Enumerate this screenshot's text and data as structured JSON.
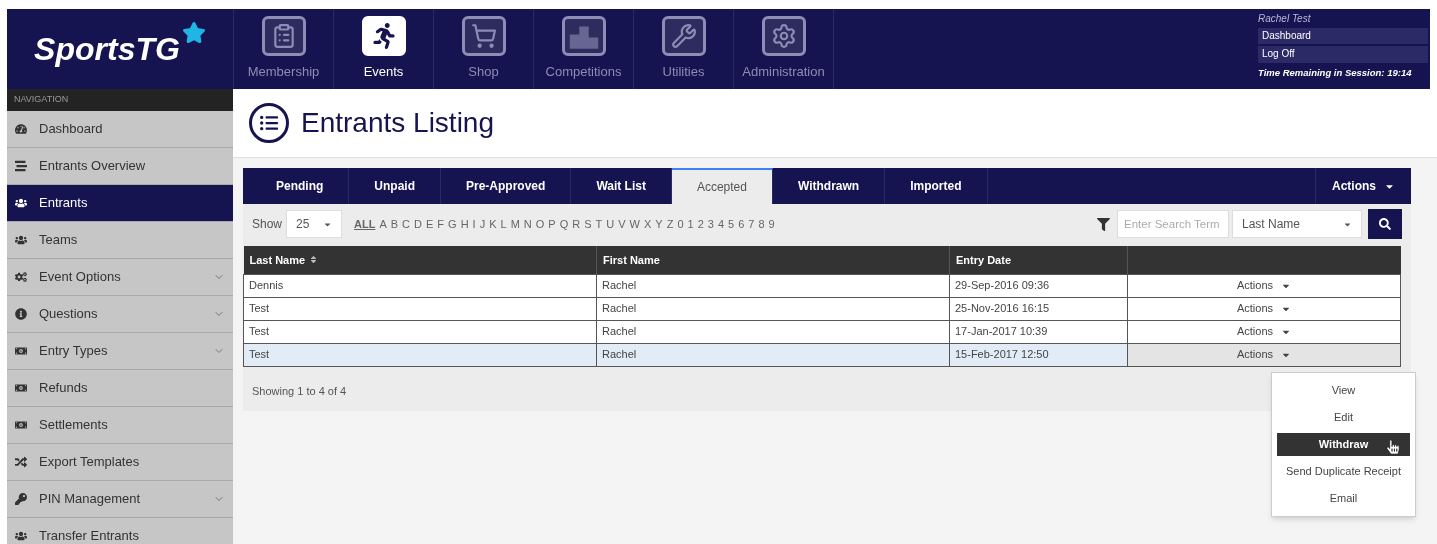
{
  "logo": {
    "text": "SportsTG"
  },
  "top_nav": [
    {
      "label": "Membership",
      "selected": false
    },
    {
      "label": "Events",
      "selected": true
    },
    {
      "label": "Shop",
      "selected": false
    },
    {
      "label": "Competitions",
      "selected": false
    },
    {
      "label": "Utilities",
      "selected": false
    },
    {
      "label": "Administration",
      "selected": false
    }
  ],
  "user": {
    "account": "Rachel Test",
    "links": [
      "Dashboard",
      "Log Off"
    ],
    "session": "Time Remaining in Session: 19:14"
  },
  "sidebar": {
    "heading": "NAVIGATION",
    "items": [
      {
        "label": "Dashboard",
        "selected": false,
        "expandable": false
      },
      {
        "label": "Entrants Overview",
        "selected": false,
        "expandable": false
      },
      {
        "label": "Entrants",
        "selected": true,
        "expandable": false
      },
      {
        "label": "Teams",
        "selected": false,
        "expandable": false
      },
      {
        "label": "Event Options",
        "selected": false,
        "expandable": true
      },
      {
        "label": "Questions",
        "selected": false,
        "expandable": true
      },
      {
        "label": "Entry Types",
        "selected": false,
        "expandable": true
      },
      {
        "label": "Refunds",
        "selected": false,
        "expandable": false
      },
      {
        "label": "Settlements",
        "selected": false,
        "expandable": false
      },
      {
        "label": "Export Templates",
        "selected": false,
        "expandable": false
      },
      {
        "label": "PIN Management",
        "selected": false,
        "expandable": true
      },
      {
        "label": "Transfer Entrants",
        "selected": false,
        "expandable": false
      }
    ]
  },
  "page_title": "Entrants Listing",
  "tabs": [
    {
      "label": "Pending",
      "selected": false
    },
    {
      "label": "Unpaid",
      "selected": false
    },
    {
      "label": "Pre-Approved",
      "selected": false
    },
    {
      "label": "Wait List",
      "selected": false
    },
    {
      "label": "Accepted",
      "selected": true
    },
    {
      "label": "Withdrawn",
      "selected": false
    },
    {
      "label": "Imported",
      "selected": false
    }
  ],
  "actions_button": "Actions",
  "toolbar": {
    "show_label": "Show",
    "page_size": "25",
    "letters": [
      {
        "label": "ALL",
        "selected": true
      },
      {
        "label": "A",
        "selected": false
      },
      {
        "label": "B",
        "selected": false
      },
      {
        "label": "C",
        "selected": false
      },
      {
        "label": "D",
        "selected": false
      },
      {
        "label": "E",
        "selected": false
      },
      {
        "label": "F",
        "selected": false
      },
      {
        "label": "G",
        "selected": false
      },
      {
        "label": "H",
        "selected": false
      },
      {
        "label": "I",
        "selected": false
      },
      {
        "label": "J",
        "selected": false
      },
      {
        "label": "K",
        "selected": false
      },
      {
        "label": "L",
        "selected": false
      },
      {
        "label": "M",
        "selected": false
      },
      {
        "label": "N",
        "selected": false
      },
      {
        "label": "O",
        "selected": false
      },
      {
        "label": "P",
        "selected": false
      },
      {
        "label": "Q",
        "selected": false
      },
      {
        "label": "R",
        "selected": false
      },
      {
        "label": "S",
        "selected": false
      },
      {
        "label": "T",
        "selected": false
      },
      {
        "label": "U",
        "selected": false
      },
      {
        "label": "V",
        "selected": false
      },
      {
        "label": "W",
        "selected": false
      },
      {
        "label": "X",
        "selected": false
      },
      {
        "label": "Y",
        "selected": false
      },
      {
        "label": "Z",
        "selected": false
      },
      {
        "label": "0",
        "selected": false
      },
      {
        "label": "1",
        "selected": false
      },
      {
        "label": "2",
        "selected": false
      },
      {
        "label": "3",
        "selected": false
      },
      {
        "label": "4",
        "selected": false
      },
      {
        "label": "5",
        "selected": false
      },
      {
        "label": "6",
        "selected": false
      },
      {
        "label": "7",
        "selected": false
      },
      {
        "label": "8",
        "selected": false
      },
      {
        "label": "9",
        "selected": false
      }
    ],
    "search_placeholder": "Enter Search Term",
    "search_field": "Last Name"
  },
  "table": {
    "columns": [
      {
        "label": "Last Name",
        "sortable": true
      },
      {
        "label": "First Name",
        "sortable": false
      },
      {
        "label": "Entry Date",
        "sortable": false
      }
    ],
    "rows": [
      {
        "cells": [
          "Dennis",
          "Rachel",
          "29-Sep-2016 09:36"
        ],
        "action": "Actions",
        "selected": false
      },
      {
        "cells": [
          "Test",
          "Rachel",
          "25-Nov-2016 16:15"
        ],
        "action": "Actions",
        "selected": false
      },
      {
        "cells": [
          "Test",
          "Rachel",
          "17-Jan-2017 10:39"
        ],
        "action": "Actions",
        "selected": false
      },
      {
        "cells": [
          "Test",
          "Rachel",
          "15-Feb-2017 12:50"
        ],
        "action": "Actions",
        "selected": true
      }
    ]
  },
  "footer": "Showing 1 to 4 of 4",
  "row_menu": [
    {
      "label": "View",
      "selected": false
    },
    {
      "label": "Edit",
      "selected": false
    },
    {
      "label": "Withdraw",
      "selected": true
    },
    {
      "label": "Send Duplicate Receipt",
      "selected": false
    },
    {
      "label": "Email",
      "selected": false
    }
  ]
}
